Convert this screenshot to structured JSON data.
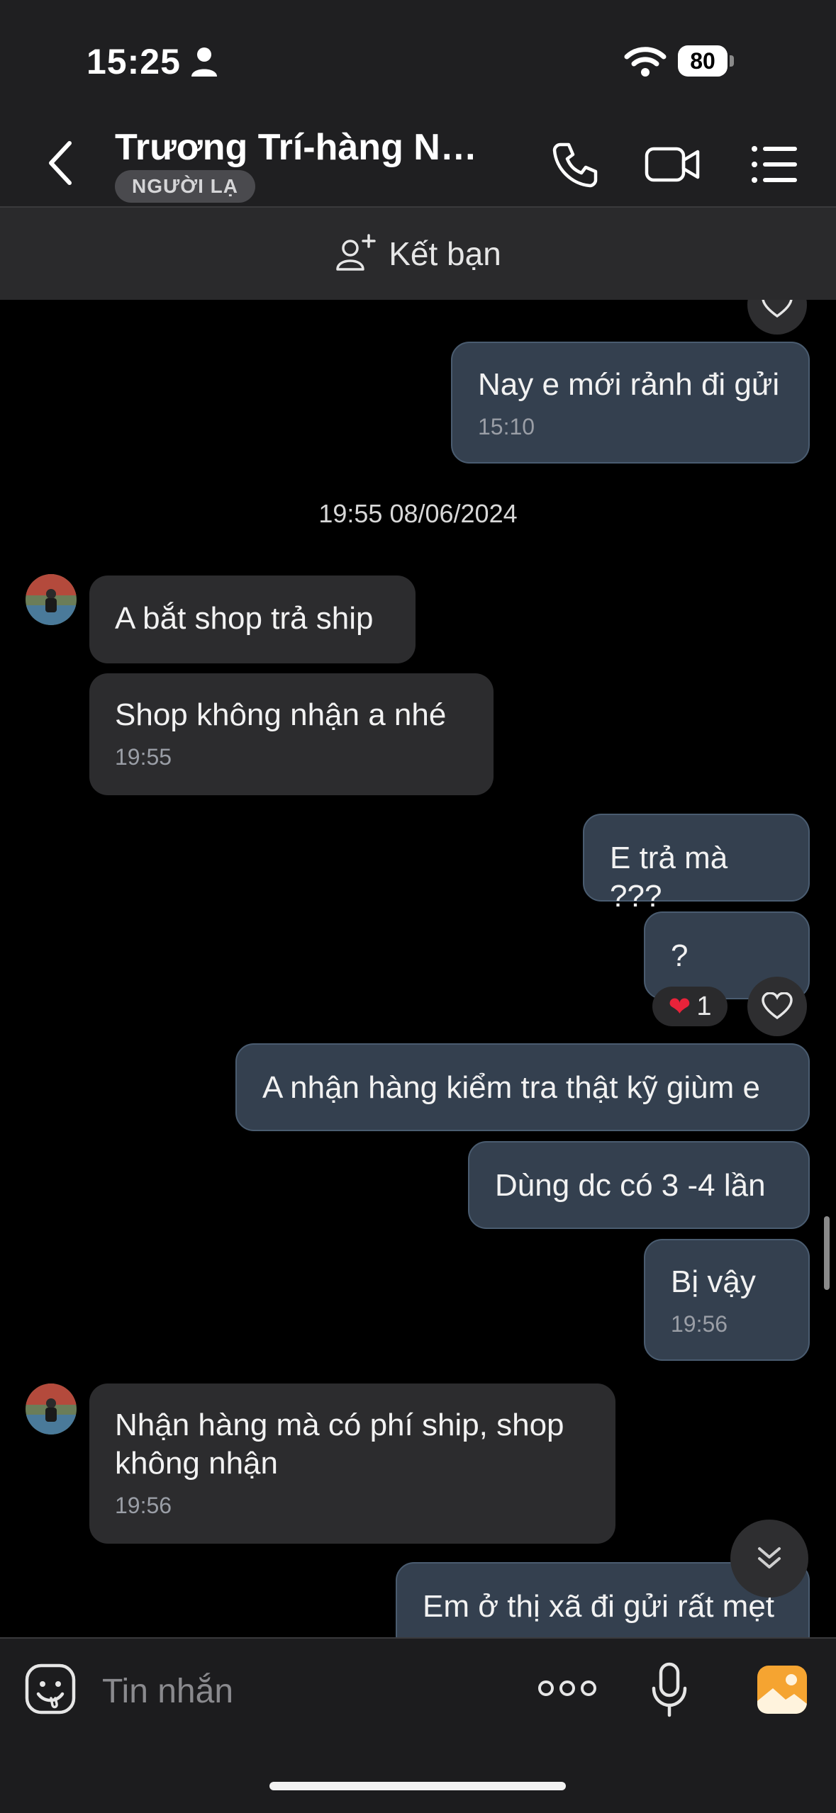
{
  "status_bar": {
    "time": "15:25",
    "battery": "80"
  },
  "header": {
    "title": "Trương Trí-hàng Nội...",
    "badge": "NGƯỜI LẠ"
  },
  "friend_bar": {
    "label": "Kết bạn"
  },
  "date_separator": "19:55 08/06/2024",
  "messages": [
    {
      "side": "out",
      "text": "Nay e mới rảnh đi gửi",
      "time": "15:10"
    },
    {
      "side": "in",
      "text": "A bắt shop trả ship"
    },
    {
      "side": "in",
      "text": "Shop không nhận a nhé",
      "time": "19:55"
    },
    {
      "side": "out",
      "text": "E trả mà ???"
    },
    {
      "side": "out",
      "text": "?"
    },
    {
      "side": "out",
      "text": "A nhận hàng kiểm tra thật kỹ giùm e"
    },
    {
      "side": "out",
      "text": "Dùng dc có 3 -4 lần"
    },
    {
      "side": "out",
      "text": "Bị vậy",
      "time": "19:56"
    },
    {
      "side": "in",
      "text": "Nhận hàng mà có phí ship, shop không nhận",
      "time": "19:56"
    },
    {
      "side": "out",
      "text": "Em ở thị xã đi gửi rất mẹt"
    }
  ],
  "reaction": {
    "emoji": "❤️",
    "count": "1"
  },
  "input": {
    "placeholder": "Tin nhắn"
  },
  "colors": {
    "outgoing_bubble": "#34404f",
    "incoming_bubble": "#2c2c2e",
    "accent_orange": "#f5a431"
  }
}
